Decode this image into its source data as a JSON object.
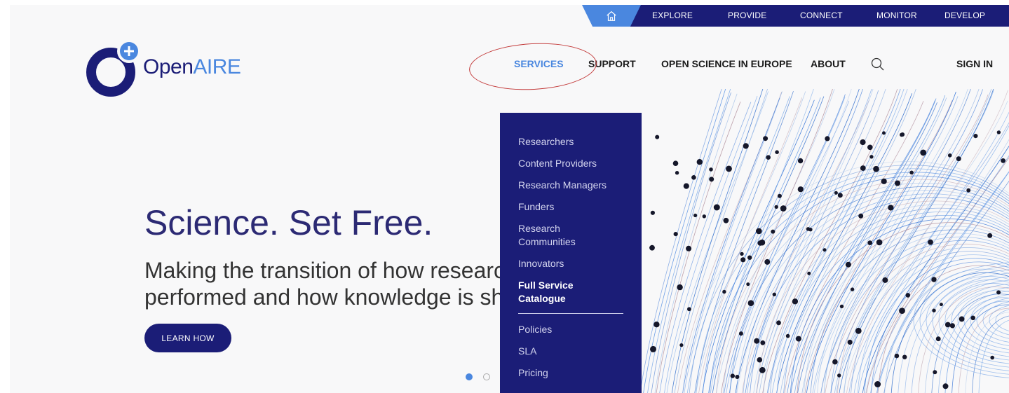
{
  "topbar": {
    "home_icon": "home-icon",
    "links": [
      "EXPLORE",
      "PROVIDE",
      "CONNECT",
      "MONITOR",
      "DEVELOP"
    ]
  },
  "logo": {
    "part1": "Open",
    "part2": "AIRE"
  },
  "nav": {
    "services": "SERVICES",
    "support": "SUPPORT",
    "open_science": "OPEN SCIENCE IN EUROPE",
    "about": "ABOUT",
    "search_icon": "search-icon",
    "sign_in": "SIGN IN"
  },
  "hero": {
    "title": "Science. Set Free.",
    "subtitle_line1": "Making the transition of how researc",
    "subtitle_line2": "performed and how knowledge is sh",
    "button": "LEARN HOW"
  },
  "dropdown": {
    "items": [
      "Researchers",
      "Content Providers",
      "Research Managers",
      "Funders",
      "Research Communities",
      "Innovators"
    ],
    "full_catalogue": "Full Service Catalogue",
    "items2": [
      "Policies",
      "SLA",
      "Pricing"
    ]
  },
  "colors": {
    "brand_dark": "#1b1d77",
    "brand_blue": "#4a87df",
    "highlight_ellipse": "#c33b3b"
  }
}
